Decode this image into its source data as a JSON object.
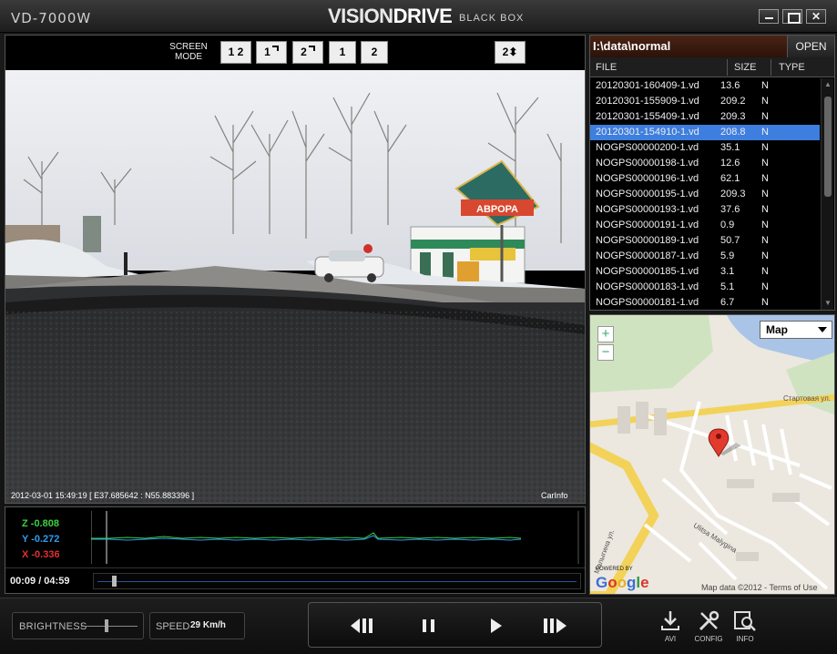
{
  "window": {
    "model": "VD-7000W",
    "brand_part1": "VISION",
    "brand_part2": "DRIVE",
    "brand_suffix": "BLACK BOX"
  },
  "screen_mode": {
    "label_line1": "SCREEN",
    "label_line2": "MODE",
    "buttons": [
      "1 2",
      "1",
      "2",
      "1",
      "2",
      "2"
    ]
  },
  "video": {
    "timestamp_overlay": "2012-03-01 15:49:19 [ E37.685642 : N55.883396 ]",
    "carinfo": "CarInfo",
    "sign_text": "АВРОРА"
  },
  "sensors": {
    "z": "Z -0.808",
    "y": "Y -0.272",
    "x": "X -0.336",
    "colors": {
      "z": "#3dd23d",
      "y": "#2e9cf0",
      "x": "#e23131"
    }
  },
  "playback": {
    "time": "00:09 / 04:59",
    "progress_fraction": 0.03
  },
  "file_browser": {
    "path": "I:\\data\\normal",
    "open_label": "OPEN",
    "columns": [
      "FILE",
      "SIZE",
      "TYPE"
    ],
    "selected_index": 3,
    "rows": [
      {
        "file": "20120301-160409-1.vd",
        "size": "13.6",
        "type": "N"
      },
      {
        "file": "20120301-155909-1.vd",
        "size": "209.2",
        "type": "N"
      },
      {
        "file": "20120301-155409-1.vd",
        "size": "209.3",
        "type": "N"
      },
      {
        "file": "20120301-154910-1.vd",
        "size": "208.8",
        "type": "N"
      },
      {
        "file": "NOGPS00000200-1.vd",
        "size": "35.1",
        "type": "N"
      },
      {
        "file": "NOGPS00000198-1.vd",
        "size": "12.6",
        "type": "N"
      },
      {
        "file": "NOGPS00000196-1.vd",
        "size": "62.1",
        "type": "N"
      },
      {
        "file": "NOGPS00000195-1.vd",
        "size": "209.3",
        "type": "N"
      },
      {
        "file": "NOGPS00000193-1.vd",
        "size": "37.6",
        "type": "N"
      },
      {
        "file": "NOGPS00000191-1.vd",
        "size": "0.9",
        "type": "N"
      },
      {
        "file": "NOGPS00000189-1.vd",
        "size": "50.7",
        "type": "N"
      },
      {
        "file": "NOGPS00000187-1.vd",
        "size": "5.9",
        "type": "N"
      },
      {
        "file": "NOGPS00000185-1.vd",
        "size": "3.1",
        "type": "N"
      },
      {
        "file": "NOGPS00000183-1.vd",
        "size": "5.1",
        "type": "N"
      },
      {
        "file": "NOGPS00000181-1.vd",
        "size": "6.7",
        "type": "N"
      }
    ]
  },
  "map": {
    "type_select": "Map",
    "zoom_in": "+",
    "zoom_out": "−",
    "powered_by": "POWERED BY",
    "google": "Google",
    "copyright": "Map data ©2012 - Terms of Use",
    "street_labels": [
      "Стартовая ул.",
      "Ulitsa Malygina",
      "Малыгина ул."
    ]
  },
  "controls": {
    "brightness_label": "BRIGHTNESS",
    "speed_label": "SPEED",
    "speed_value": "29 Km/h",
    "tools": {
      "avi": "AVI",
      "config": "CONFIG",
      "info": "INFO"
    }
  }
}
